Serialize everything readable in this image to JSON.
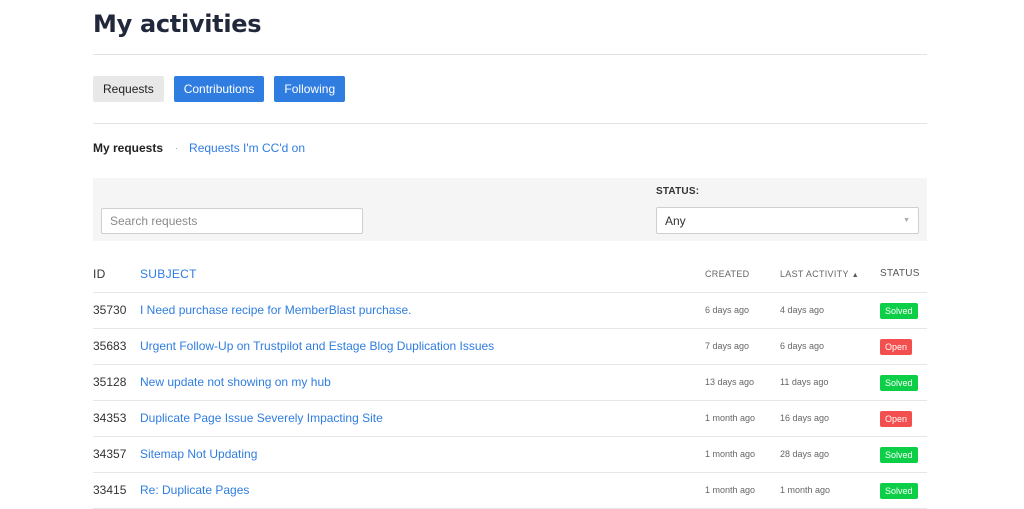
{
  "page_title": "My activities",
  "tabs": [
    {
      "label": "Requests",
      "state": "inactive"
    },
    {
      "label": "Contributions",
      "state": "active"
    },
    {
      "label": "Following",
      "state": "active"
    }
  ],
  "subnav": {
    "current": "My requests",
    "separator": "·",
    "link": "Requests I'm CC'd on"
  },
  "filter": {
    "search_placeholder": "Search requests",
    "status_label": "STATUS:",
    "status_value": "Any"
  },
  "table": {
    "headers": {
      "id": "ID",
      "subject": "SUBJECT",
      "created": "CREATED",
      "last_activity": "LAST ACTIVITY",
      "status": "STATUS"
    },
    "rows": [
      {
        "id": "35730",
        "subject": "I Need purchase recipe for MemberBlast purchase.",
        "created": "6 days ago",
        "last_activity": "4 days ago",
        "status": "Solved"
      },
      {
        "id": "35683",
        "subject": "Urgent Follow-Up on Trustpilot and Estage Blog Duplication Issues",
        "created": "7 days ago",
        "last_activity": "6 days ago",
        "status": "Open"
      },
      {
        "id": "35128",
        "subject": "New update not showing on my hub",
        "created": "13 days ago",
        "last_activity": "11 days ago",
        "status": "Solved"
      },
      {
        "id": "34353",
        "subject": "Duplicate Page Issue Severely Impacting Site",
        "created": "1 month ago",
        "last_activity": "16 days ago",
        "status": "Open"
      },
      {
        "id": "34357",
        "subject": "Sitemap Not Updating",
        "created": "1 month ago",
        "last_activity": "28 days ago",
        "status": "Solved"
      },
      {
        "id": "33415",
        "subject": "Re: Duplicate Pages",
        "created": "1 month ago",
        "last_activity": "1 month ago",
        "status": "Solved"
      }
    ]
  },
  "colors": {
    "accent": "#2f7de1",
    "solved": "#0ccf47",
    "open": "#f34f4f",
    "title": "#22283c"
  }
}
